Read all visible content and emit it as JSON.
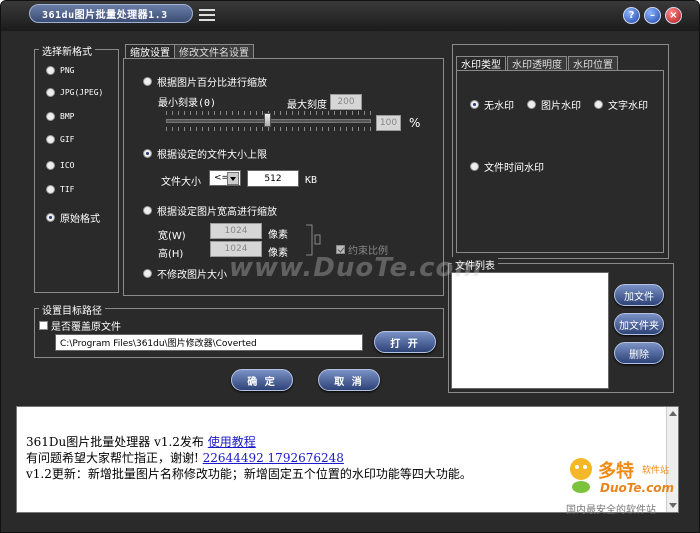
{
  "app": {
    "title": "361du图片批量处理器1.3"
  },
  "titlebar": {
    "help_label": "?",
    "min_label": "–",
    "close_label": "×"
  },
  "format_panel": {
    "caption": "选择新格式",
    "options": [
      "PNG",
      "JPG(JPEG)",
      "BMP",
      "GIF",
      "ICO",
      "TIF",
      "原始格式"
    ],
    "selected": "原始格式"
  },
  "resize_tabs": {
    "tab1": "缩放设置",
    "tab2": "修改文件名设置"
  },
  "resize": {
    "opt_percent": "根据图片百分比进行缩放",
    "min_scale_label": "最小刻录(0)",
    "max_scale_label": "最大刻度",
    "max_scale_value": "200",
    "percent_value": "100",
    "percent_unit": "%",
    "opt_filesize": "根据设定的文件大小上限",
    "filesize_label": "文件大小",
    "filesize_op": "<=",
    "filesize_value": "512",
    "filesize_unit": "KB",
    "opt_dimensions": "根据设定图片宽高进行缩放",
    "width_label": "宽(W)",
    "width_value": "1024",
    "height_label": "高(H)",
    "height_value": "1024",
    "px_unit": "像素",
    "keep_ratio_label": "约束比例",
    "opt_none": "不修改图片大小",
    "selected": "根据设定的文件大小上限"
  },
  "output": {
    "caption": "设置目标路径",
    "overwrite_label": "是否覆盖原文件",
    "path_value": "C:\\Program Files\\361du\\图片修改器\\Coverted",
    "open_button": "打 开"
  },
  "actions": {
    "ok": "确 定",
    "cancel": "取 消"
  },
  "watermark_tabs": {
    "tab1": "水印类型",
    "tab2": "水印透明度",
    "tab3": "水印位置"
  },
  "watermark": {
    "opt_none": "无水印",
    "opt_image": "图片水印",
    "opt_text": "文字水印",
    "opt_time": "文件时间水印",
    "selected": "无水印"
  },
  "file_list": {
    "caption": "文件列表",
    "add_file": "加文件",
    "add_folder": "加文件夹",
    "delete": "删除"
  },
  "info": {
    "line1_text": "361Du图片批量处理器  v1.2发布",
    "line1_link": "使用教程",
    "line2_text": "有问题希望大家帮忙指正，谢谢!",
    "line2_link": "22644492 1792676248",
    "line3_text": "v1.2更新：新增批量图片名称修改功能；新增固定五个位置的水印功能等四大功能。"
  },
  "overlay": {
    "watermark_text": "www.DuoTe.com",
    "logo_cn": "多特",
    "logo_sub": "软件站",
    "logo_en": "DuoTe.com",
    "logo_slogan": "国内最安全的软件站"
  }
}
